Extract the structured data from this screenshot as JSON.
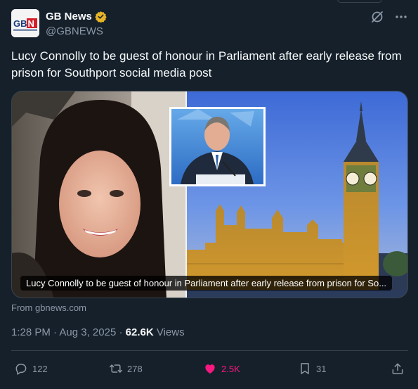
{
  "author": {
    "name": "GB News",
    "handle": "@GBNEWS",
    "avatar_text": "GBN"
  },
  "post": {
    "text": "Lucy Connolly to be guest of honour in Parliament after early release from prison for Southport social media post"
  },
  "media": {
    "caption": "Lucy Connolly to be guest of honour in Parliament after early release from prison for So...",
    "source": "From gbnews.com"
  },
  "meta": {
    "time": "1:28 PM",
    "separator": "·",
    "date": "Aug 3, 2025",
    "views_count": "62.6K",
    "views_label": "Views"
  },
  "actions": {
    "replies": "122",
    "reposts": "278",
    "likes": "2.5K",
    "bookmarks": "31"
  },
  "colors": {
    "background": "#15202b",
    "text": "#f7f9f9",
    "muted": "#8b98a5",
    "border": "#38444d",
    "like": "#f91880",
    "verified": "#e8b427"
  },
  "icons": [
    "verified-badge-icon",
    "grok-icon",
    "more-icon",
    "reply-icon",
    "repost-icon",
    "like-icon",
    "bookmark-icon",
    "share-icon"
  ]
}
